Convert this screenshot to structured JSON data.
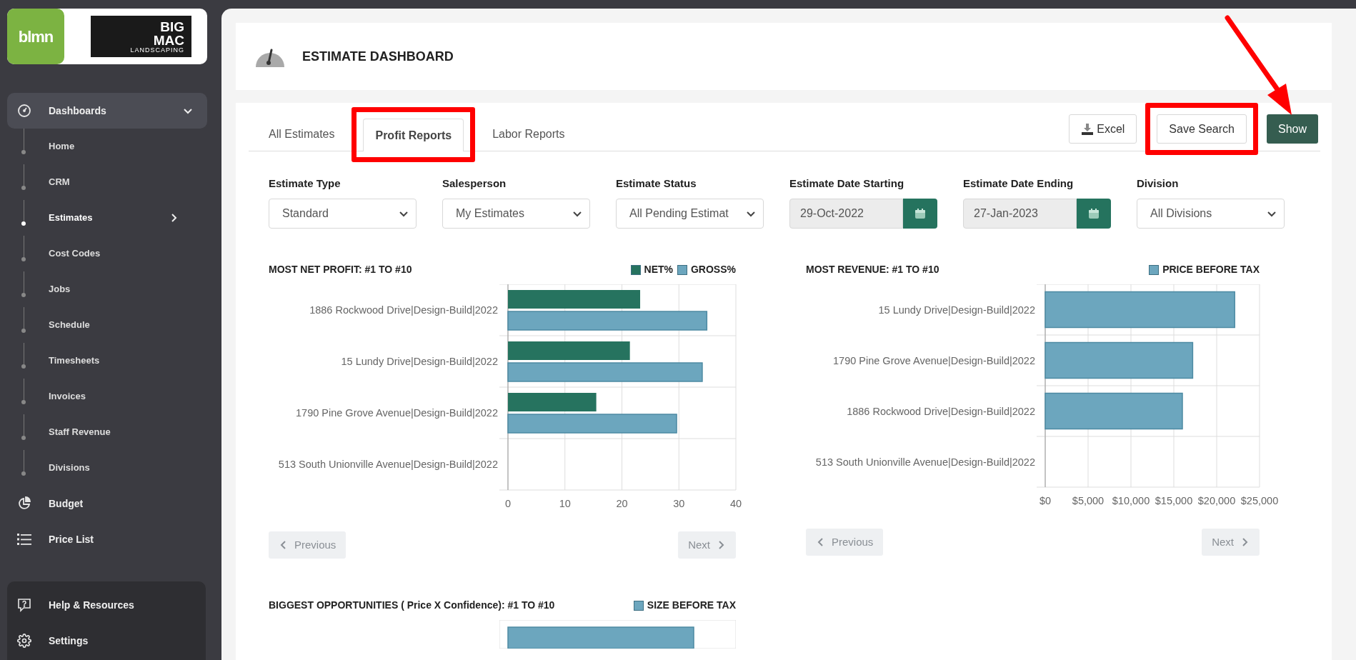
{
  "sidebar": {
    "brand": "blmn",
    "company_logo": [
      "BIG",
      "MAC",
      "LANDSCAPING"
    ],
    "nav": [
      {
        "label": "Dashboards",
        "expanded": true,
        "children": [
          {
            "label": "Home",
            "selected": false,
            "has_submenu": false
          },
          {
            "label": "CRM",
            "selected": false,
            "has_submenu": false
          },
          {
            "label": "Estimates",
            "selected": true,
            "has_submenu": true
          },
          {
            "label": "Cost Codes",
            "selected": false,
            "has_submenu": false
          },
          {
            "label": "Jobs",
            "selected": false,
            "has_submenu": false
          },
          {
            "label": "Schedule",
            "selected": false,
            "has_submenu": false
          },
          {
            "label": "Timesheets",
            "selected": false,
            "has_submenu": false
          },
          {
            "label": "Invoices",
            "selected": false,
            "has_submenu": false
          },
          {
            "label": "Staff Revenue",
            "selected": false,
            "has_submenu": false
          },
          {
            "label": "Divisions",
            "selected": false,
            "has_submenu": false
          }
        ]
      },
      {
        "label": "Budget",
        "expanded": false
      },
      {
        "label": "Price List",
        "expanded": false
      }
    ],
    "footer": [
      {
        "label": "Help & Resources"
      },
      {
        "label": "Settings"
      }
    ]
  },
  "header": {
    "title": "ESTIMATE DASHBOARD"
  },
  "tabs": [
    {
      "label": "All Estimates",
      "selected": false,
      "highlighted": false
    },
    {
      "label": "Profit Reports",
      "selected": true,
      "highlighted": true
    },
    {
      "label": "Labor Reports",
      "selected": false,
      "highlighted": false
    }
  ],
  "actions": [
    {
      "label": "Excel",
      "kind": "export",
      "highlighted": false
    },
    {
      "label": "Save Search",
      "kind": "outline",
      "highlighted": true
    },
    {
      "label": "Show",
      "kind": "primary",
      "highlighted": false
    }
  ],
  "filters": [
    {
      "label": "Estimate Type",
      "kind": "select",
      "value": "Standard"
    },
    {
      "label": "Salesperson",
      "kind": "select",
      "value": "My Estimates"
    },
    {
      "label": "Estimate Status",
      "kind": "select",
      "value": "All Pending Estimat"
    },
    {
      "label": "Estimate Date Starting",
      "kind": "date",
      "value": "29-Oct-2022"
    },
    {
      "label": "Estimate Date Ending",
      "kind": "date",
      "value": "27-Jan-2023"
    },
    {
      "label": "Division",
      "kind": "select",
      "value": "All Divisions"
    }
  ],
  "charts": [
    {
      "title": "MOST NET PROFIT: #1 TO #10",
      "chart_data": {
        "type": "bar",
        "orientation": "horizontal",
        "categories": [
          "1886 Rockwood Drive|Design-Build|2022",
          "15 Lundy Drive|Design-Build|2022",
          "1790 Pine Grove Avenue|Design-Build|2022",
          "513 South Unionville Avenue|Design-Build|2022"
        ],
        "series": [
          {
            "name": "NET%",
            "color": "#26735f",
            "values": [
              23.2,
              21.4,
              15.5,
              null
            ]
          },
          {
            "name": "GROSS%",
            "color": "#6ca6be",
            "values": [
              34.9,
              34.1,
              29.6,
              null
            ]
          }
        ],
        "xlim": [
          0,
          40
        ],
        "xticks": [
          0,
          10,
          20,
          30,
          40
        ],
        "grid": true
      },
      "pager": {
        "previous": "Previous",
        "next": "Next"
      }
    },
    {
      "title": "MOST REVENUE: #1 TO #10",
      "chart_data": {
        "type": "bar",
        "orientation": "horizontal",
        "categories": [
          "15 Lundy Drive|Design-Build|2022",
          "1790 Pine Grove Avenue|Design-Build|2022",
          "1886 Rockwood Drive|Design-Build|2022",
          "513 South Unionville Avenue|Design-Build|2022"
        ],
        "series": [
          {
            "name": "PRICE BEFORE TAX",
            "color": "#6ca6be",
            "values": [
              22100,
              17200,
              16000,
              null
            ]
          }
        ],
        "xlim": [
          0,
          25000
        ],
        "xticks": [
          {
            "value": 0,
            "label": "$0"
          },
          {
            "value": 5000,
            "label": "$5,000"
          },
          {
            "value": 10000,
            "label": "$10,000"
          },
          {
            "value": 15000,
            "label": "$15,000"
          },
          {
            "value": 20000,
            "label": "$20,000"
          },
          {
            "value": 25000,
            "label": "$25,000"
          }
        ],
        "grid": true
      },
      "pager": {
        "previous": "Previous",
        "next": "Next"
      }
    }
  ],
  "opportunities": {
    "title": "BIGGEST OPPORTUNITIES ( Price X Confidence): #1 TO #10",
    "legend": [
      {
        "label": "SIZE BEFORE TAX",
        "color": "#6ca6be"
      }
    ]
  }
}
